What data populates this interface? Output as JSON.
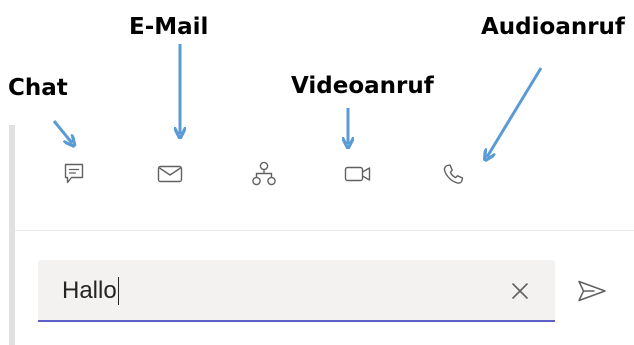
{
  "annotations": {
    "email": "E-Mail",
    "audio_call": "Audioanruf",
    "chat": "Chat",
    "video_call": "Videoanruf"
  },
  "colors": {
    "annotation_arrow": "#5b9bd5",
    "icon": "#616161",
    "input_underline": "#5b5fc7",
    "input_background": "#f3f2f1"
  },
  "toolbar": {
    "icons": [
      "chat-icon",
      "mail-icon",
      "org-chart-icon",
      "video-icon",
      "phone-icon"
    ]
  },
  "compose": {
    "message_value": "Hallo",
    "clear_icon": "close-icon",
    "send_icon": "send-icon"
  }
}
